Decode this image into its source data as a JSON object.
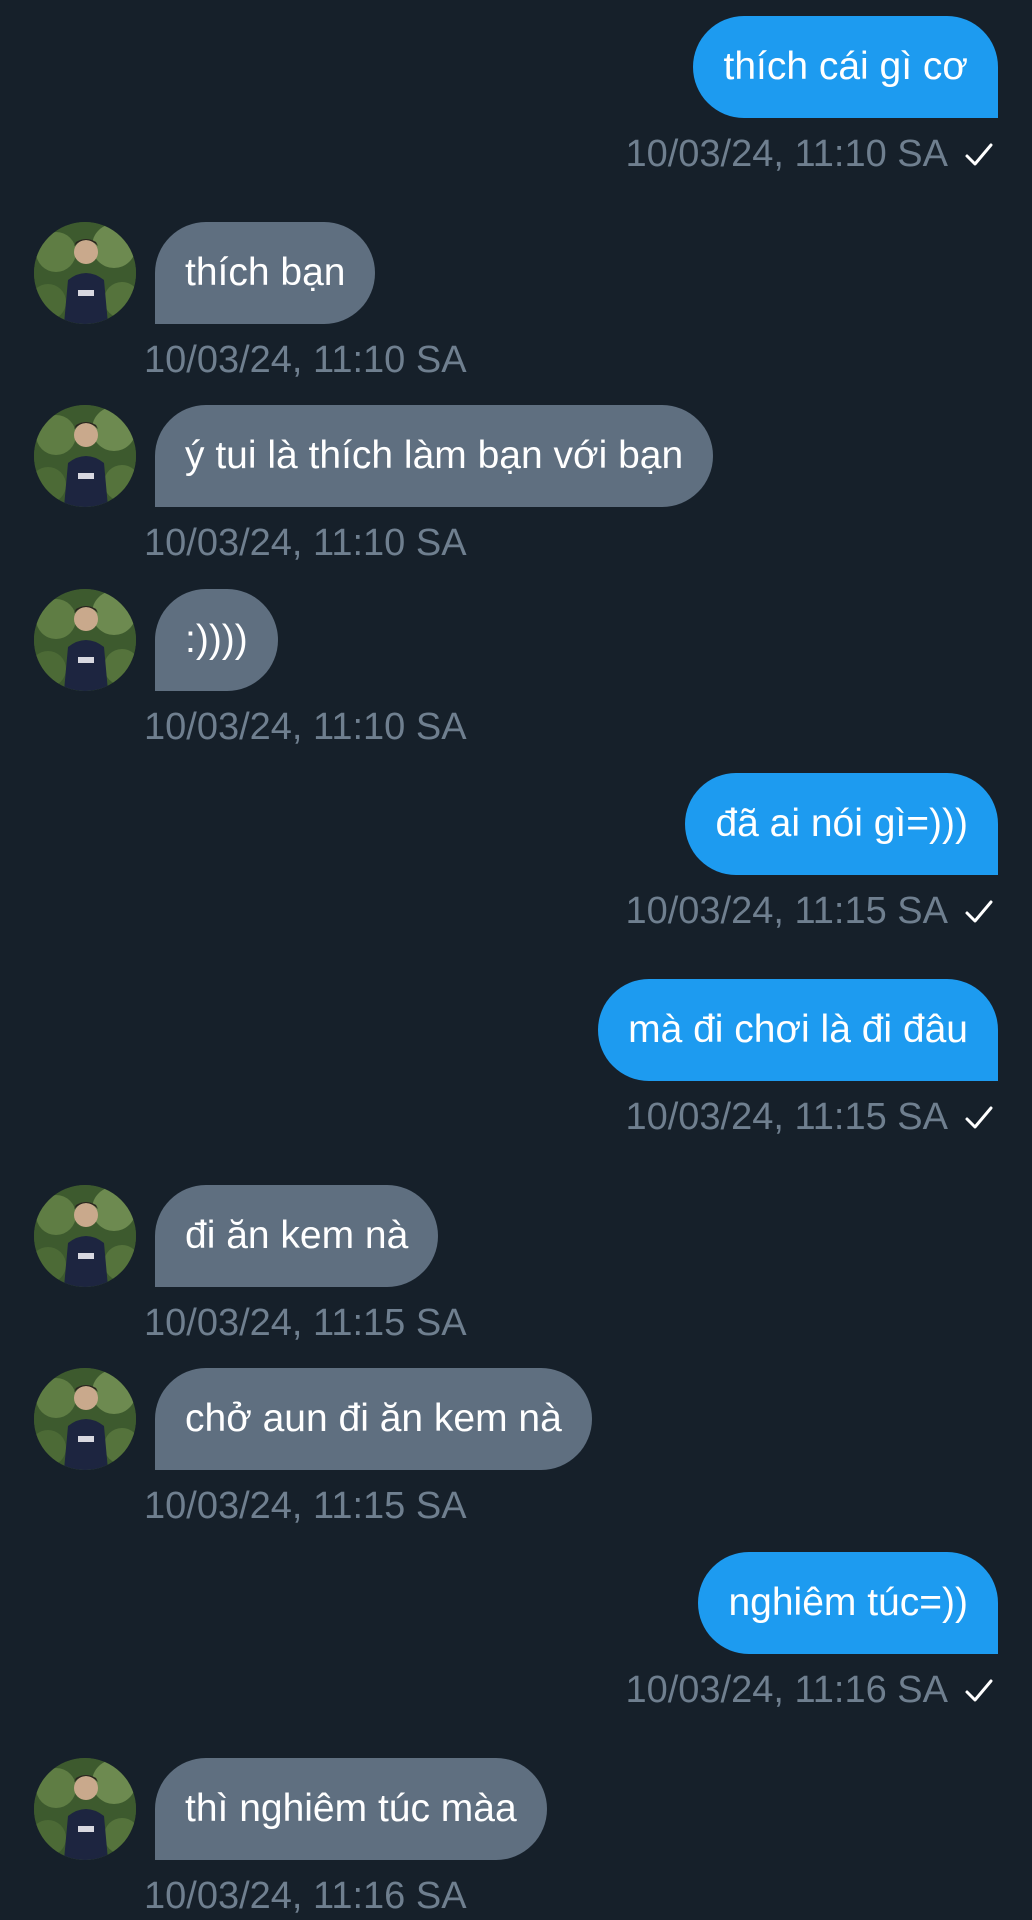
{
  "colors": {
    "background": "#16202a",
    "outgoing_bubble": "#1d9bf0",
    "incoming_bubble": "#5f6f80",
    "timestamp": "#6f7f8f"
  },
  "messages": [
    {
      "dir": "out",
      "text": "thích cái gì cơ",
      "time": "10/03/24, 11:10 SA",
      "read_icon": "check-icon"
    },
    {
      "dir": "in",
      "text": "thích bạn",
      "time": "10/03/24, 11:10 SA"
    },
    {
      "dir": "in",
      "text": "ý tui là thích làm bạn với bạn",
      "time": "10/03/24, 11:10 SA"
    },
    {
      "dir": "in",
      "text": ":))))",
      "time": "10/03/24, 11:10 SA"
    },
    {
      "dir": "out",
      "text": "đã ai nói gì=)))",
      "time": "10/03/24, 11:15 SA",
      "read_icon": "check-icon"
    },
    {
      "dir": "out",
      "text": "mà đi chơi là đi đâu",
      "time": "10/03/24, 11:15 SA",
      "read_icon": "check-icon"
    },
    {
      "dir": "in",
      "text": "đi ăn kem nà",
      "time": "10/03/24, 11:15 SA"
    },
    {
      "dir": "in",
      "text": "chở aun đi ăn kem nà",
      "time": "10/03/24, 11:15 SA"
    },
    {
      "dir": "out",
      "text": "nghiêm túc=))",
      "time": "10/03/24, 11:16 SA",
      "read_icon": "check-icon"
    },
    {
      "dir": "in",
      "text": "thì nghiêm túc màa",
      "time": "10/03/24, 11:16 SA"
    }
  ]
}
